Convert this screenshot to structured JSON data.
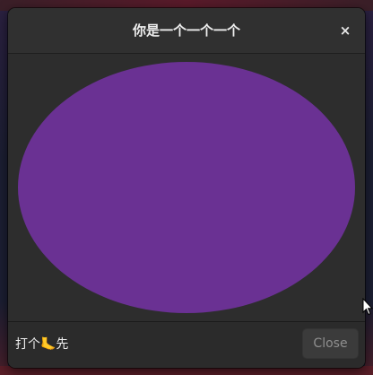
{
  "dialog": {
    "title": "你是一个一个一个",
    "close_icon": "×",
    "message": "打个🦶先",
    "close_button_label": "Close"
  },
  "colors": {
    "ellipse_fill": "#6a3193",
    "dialog_bg": "#2d2d2d"
  }
}
